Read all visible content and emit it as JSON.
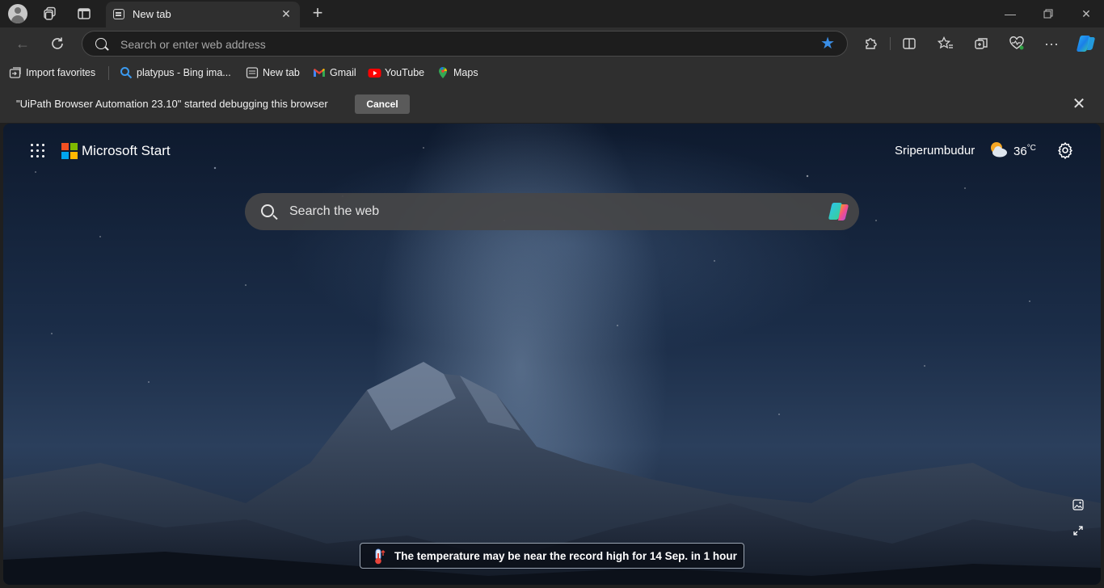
{
  "tab": {
    "title": "New tab",
    "close_glyph": "✕"
  },
  "toolbar": {
    "address_placeholder": "Search or enter web address",
    "accent": "#3a8ee6"
  },
  "favorites": [
    {
      "label": "Import favorites",
      "icon": "import-favorites-icon"
    },
    {
      "label": "platypus - Bing ima...",
      "icon": "bing-search-icon"
    },
    {
      "label": "New tab",
      "icon": "new-tab-page-icon"
    },
    {
      "label": "Gmail",
      "icon": "gmail-icon"
    },
    {
      "label": "YouTube",
      "icon": "youtube-icon"
    },
    {
      "label": "Maps",
      "icon": "maps-icon"
    }
  ],
  "infobar": {
    "message": "\"UiPath Browser Automation 23.10\" started debugging this browser",
    "cancel_label": "Cancel"
  },
  "start": {
    "brand": "Microsoft Start",
    "location": "Sriperumbudur",
    "temperature": "36",
    "temperature_unit": "°C",
    "search_placeholder": "Search the web",
    "notice": "The temperature may be near the record high for 14 Sep. in 1 hour"
  }
}
